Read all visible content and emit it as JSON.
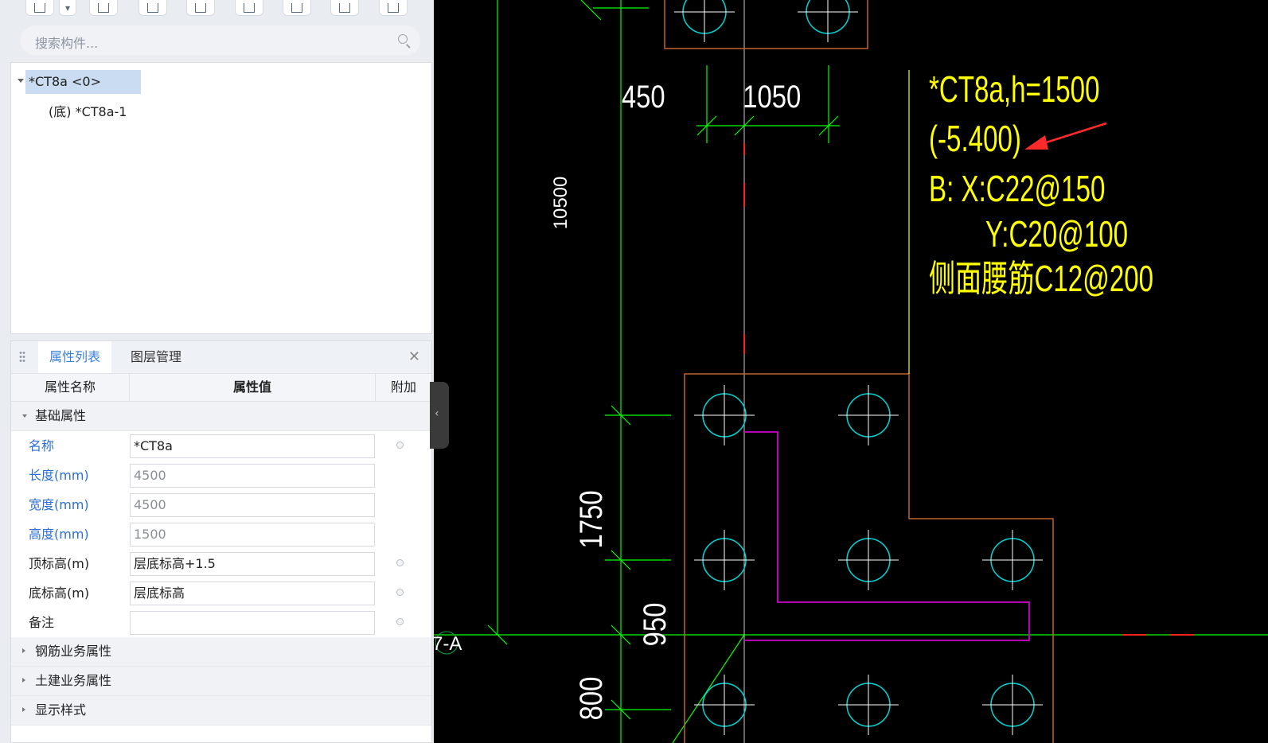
{
  "search": {
    "placeholder": "搜索构件..."
  },
  "tree": {
    "root": "*CT8a <0>",
    "child": "(底) *CT8a-1"
  },
  "panel": {
    "tabs": [
      "属性列表",
      "图层管理"
    ],
    "columns": {
      "name": "属性名称",
      "value": "属性值",
      "extra": "附加"
    },
    "groups": {
      "basic": "基础属性",
      "rebar": "钢筋业务属性",
      "civil": "土建业务属性",
      "display": "显示样式"
    },
    "rows": [
      {
        "name": "名称",
        "value": "*CT8a"
      },
      {
        "name": "长度(mm)",
        "value": "4500"
      },
      {
        "name": "宽度(mm)",
        "value": "4500"
      },
      {
        "name": "高度(mm)",
        "value": "1500"
      },
      {
        "name": "顶标高(m)",
        "value": "层底标高+1.5"
      },
      {
        "name": "底标高(m)",
        "value": "层底标高"
      },
      {
        "name": "备注",
        "value": ""
      }
    ]
  },
  "drawing": {
    "dims": {
      "d450": "450",
      "d1050": "1050",
      "d10500": "10500",
      "d1750": "1750",
      "d950": "950",
      "d800": "800"
    },
    "annotation": [
      "*CT8a,h=1500",
      "(-5.400)",
      "B: X:C22@150",
      "Y:C20@100",
      "侧面腰筋C12@200"
    ],
    "axis_label": "7-A",
    "colors": {
      "dim": "#00ff00",
      "outline": "#c0642a",
      "pile": "#00d5d5",
      "annotation": "#ffff00",
      "beam": "#d000d0",
      "arrow": "#ff2a2a"
    }
  }
}
